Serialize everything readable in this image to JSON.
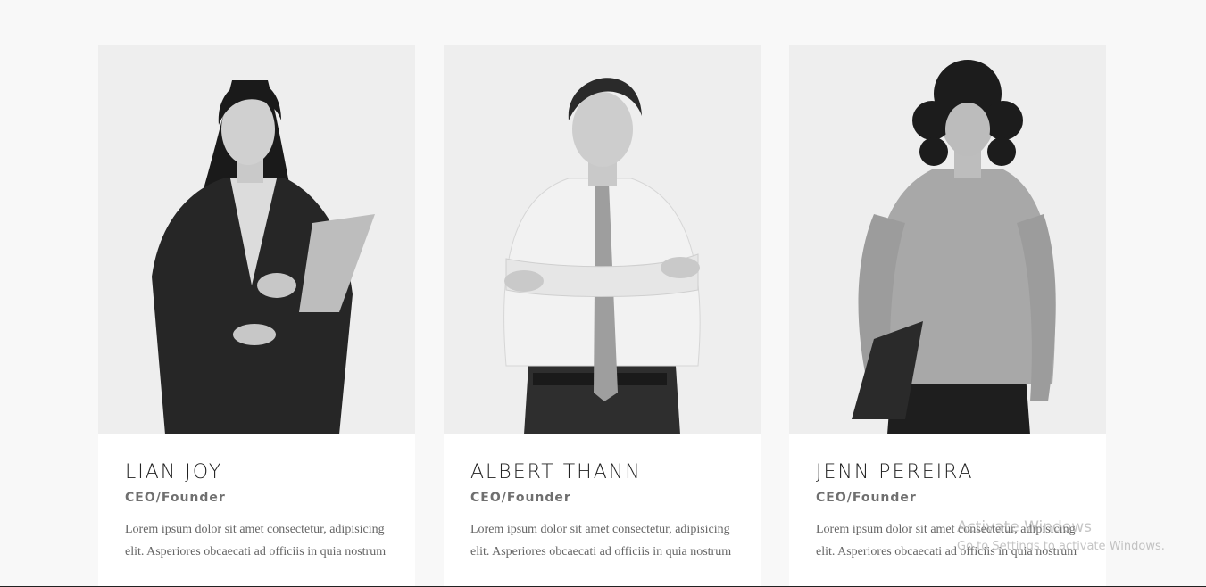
{
  "team": [
    {
      "name": "LIAN JOY",
      "role": "CEO/Founder",
      "description": "Lorem ipsum dolor sit amet consectetur, adipisicing elit. Asperiores obcaecati ad officiis in quia nostrum"
    },
    {
      "name": "ALBERT THANN",
      "role": "CEO/Founder",
      "description": "Lorem ipsum dolor sit amet consectetur, adipisicing elit. Asperiores obcaecati ad officiis in quia nostrum"
    },
    {
      "name": "JENN PEREIRA",
      "role": "CEO/Founder",
      "description": "Lorem ipsum dolor sit amet consectetur, adipisicing elit. Asperiores obcaecati ad officiis in quia nostrum"
    }
  ],
  "watermark": {
    "title": "Activate Windows",
    "subtitle": "Go to Settings to activate Windows."
  }
}
